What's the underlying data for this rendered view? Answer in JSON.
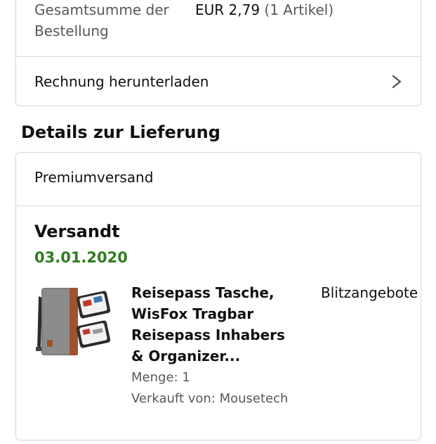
{
  "order_summary": {
    "total_label": "Gesamtsumme der Bestellung",
    "total_value": "EUR 2,79",
    "total_count": "(1 Artikel)",
    "invoice_label": "Rechnung herunterladen",
    "invoice_icon": "chevron-right-icon"
  },
  "delivery": {
    "section_title": "Details zur Lieferung",
    "shipping_type": "Premiumversand",
    "status": "Versandt",
    "date": "03.01.2020",
    "item": {
      "title": "Reisepass Tasche, WisFox Tragbar Reisepass Inhabers & Organizer...",
      "quantity": "Menge: 1",
      "seller": "Verkauft von: Mousetech",
      "deal_tag": "Blitzangebote",
      "image_icon": "product-image"
    }
  },
  "colors": {
    "date_green": "#2e7d1e",
    "secondary_text": "#565959",
    "border": "#d5d9d9"
  }
}
